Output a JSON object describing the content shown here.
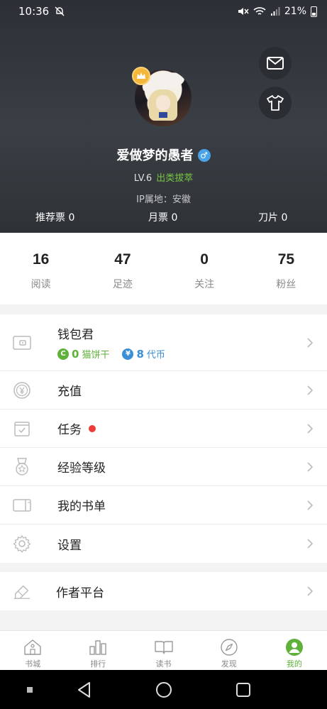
{
  "status_bar": {
    "time": "10:36",
    "battery": "21%"
  },
  "profile": {
    "name": "爱做梦的愚者",
    "gender_symbol": "♂",
    "level": "LV.6",
    "level_title": "出类拔萃",
    "ip": "IP属地：安徽",
    "tickets": [
      {
        "label": "推荐票 0"
      },
      {
        "label": "月票 0"
      },
      {
        "label": "刀片 0"
      }
    ]
  },
  "stats": [
    {
      "value": "16",
      "label": "阅读"
    },
    {
      "value": "47",
      "label": "足迹"
    },
    {
      "value": "0",
      "label": "关注"
    },
    {
      "value": "75",
      "label": "粉丝"
    }
  ],
  "wallet": {
    "title": "钱包君",
    "coin_a_value": "0",
    "coin_a_label": "猫饼干",
    "coin_b_value": "8",
    "coin_b_label": "代币"
  },
  "menu": [
    {
      "label": "充值",
      "icon": "yuan-circle-icon"
    },
    {
      "label": "任务",
      "icon": "task-check-icon",
      "has_dot": true
    },
    {
      "label": "经验等级",
      "icon": "medal-icon"
    },
    {
      "label": "我的书单",
      "icon": "book-list-icon"
    }
  ],
  "settings": {
    "label": "设置",
    "icon": "gear-icon"
  },
  "author": {
    "label": "作者平台",
    "icon": "pen-icon"
  },
  "tabs": [
    {
      "label": "书城",
      "icon": "bookstore-icon"
    },
    {
      "label": "排行",
      "icon": "ranking-icon"
    },
    {
      "label": "读书",
      "icon": "book-open-icon"
    },
    {
      "label": "发现",
      "icon": "compass-icon"
    },
    {
      "label": "我的",
      "icon": "profile-icon",
      "active": true
    }
  ],
  "colors": {
    "accent": "#5fb13a",
    "notify_dot": "#ee3b36",
    "coin_b": "#3a8fd6"
  }
}
